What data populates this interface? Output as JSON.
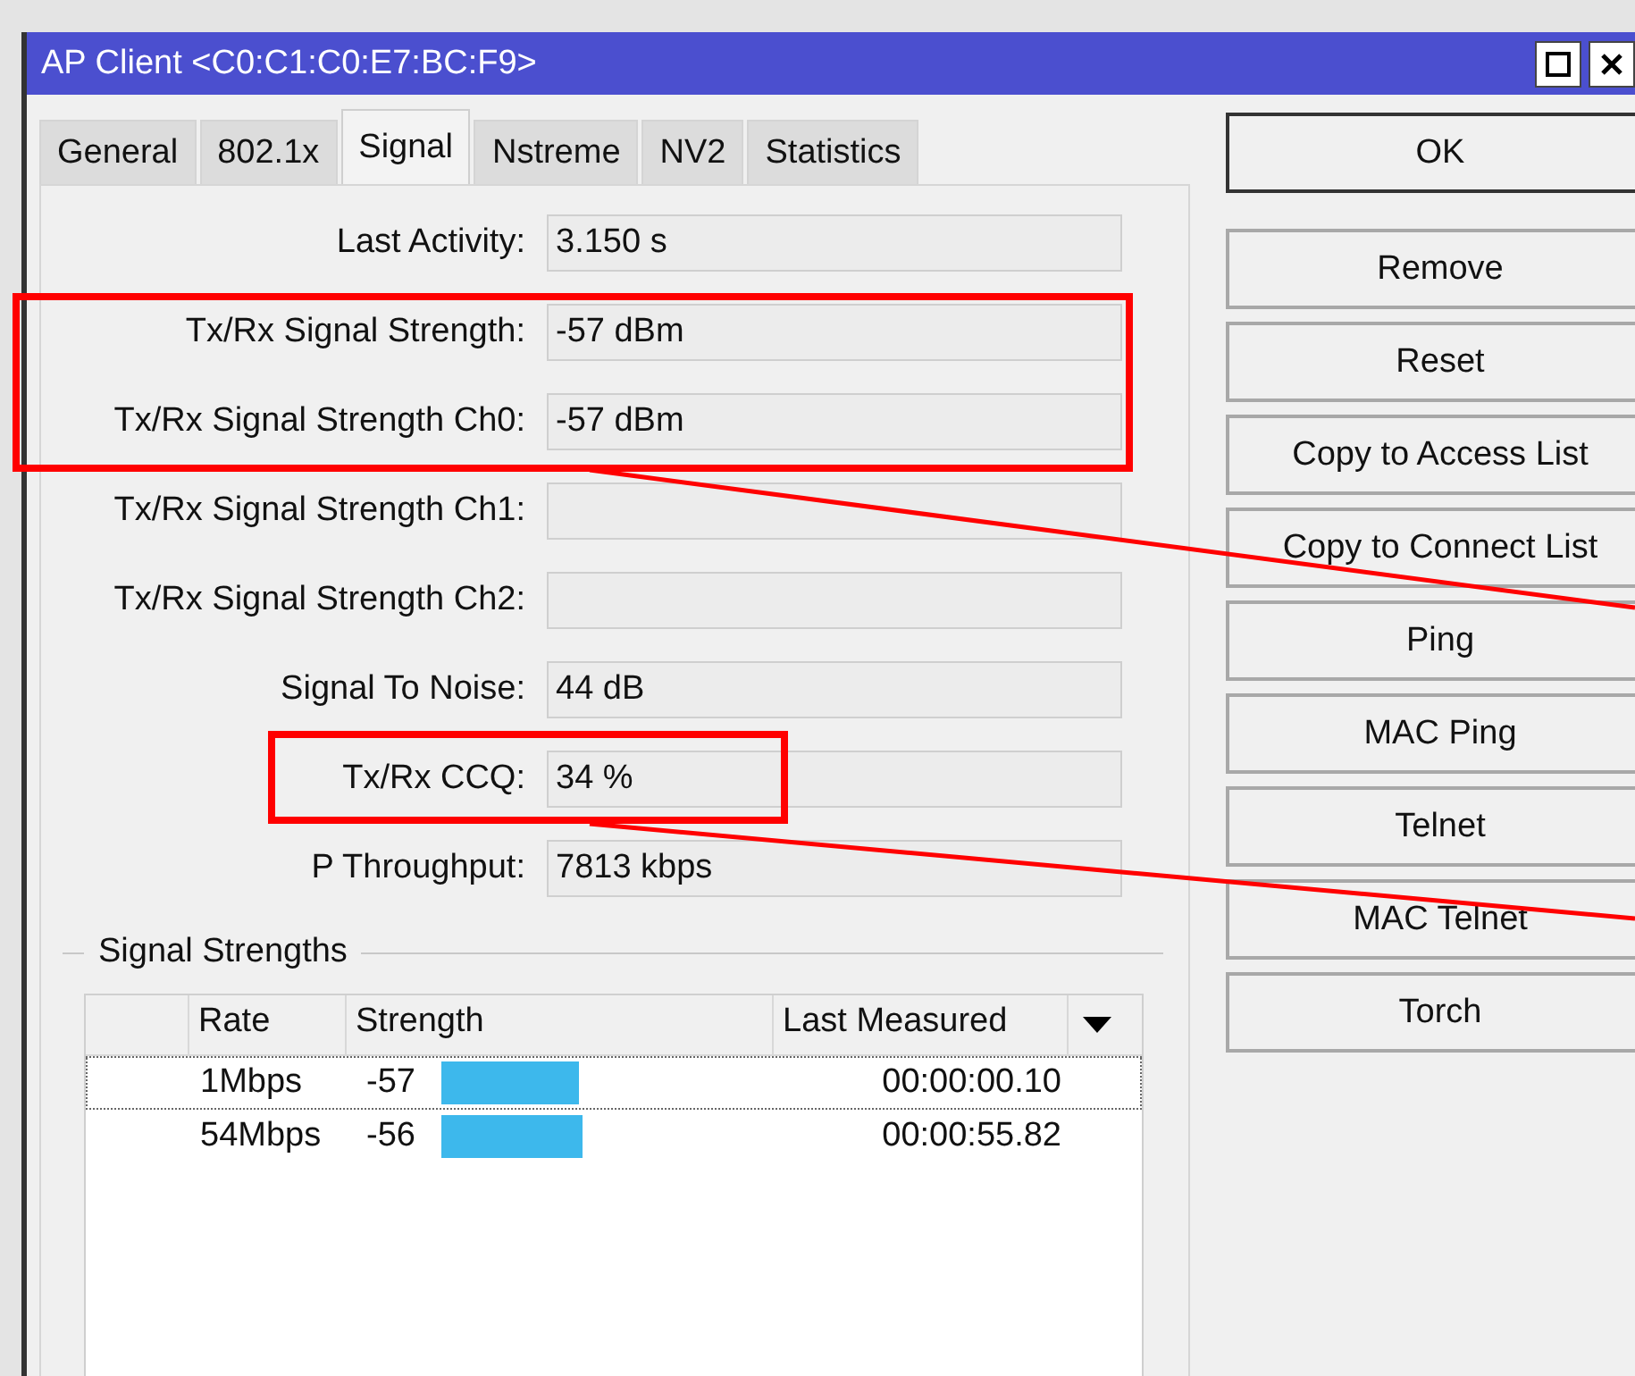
{
  "window": {
    "title": "AP Client <C0:C1:C0:E7:BC:F9>"
  },
  "tabs": [
    {
      "label": "General",
      "selected": false
    },
    {
      "label": "802.1x",
      "selected": false
    },
    {
      "label": "Signal",
      "selected": true
    },
    {
      "label": "Nstreme",
      "selected": false
    },
    {
      "label": "NV2",
      "selected": false
    },
    {
      "label": "Statistics",
      "selected": false
    }
  ],
  "fields": [
    {
      "label": "Last Activity:",
      "value": "3.150 s"
    },
    {
      "label": "Tx/Rx Signal Strength:",
      "value": "-57 dBm"
    },
    {
      "label": "Tx/Rx Signal Strength Ch0:",
      "value": "-57 dBm"
    },
    {
      "label": "Tx/Rx Signal Strength Ch1:"
    },
    {
      "label": "Tx/Rx Signal Strength Ch2:"
    },
    {
      "label": "Signal To Noise:",
      "value": "44 dB"
    },
    {
      "label": "Tx/Rx CCQ:",
      "value": "34 %"
    },
    {
      "label": "P Throughput:",
      "value": "7813 kbps"
    }
  ],
  "signal_strengths": {
    "title": "Signal Strengths",
    "columns": [
      "Rate",
      "Strength",
      "Last Measured"
    ],
    "rows": [
      {
        "rate": "1Mbps",
        "strength": "-57",
        "level": 0.43,
        "last_measured": "00:00:00.10",
        "selected": true
      },
      {
        "rate": "54Mbps",
        "strength": "-56",
        "level": 0.44,
        "last_measured": "00:00:55.82",
        "selected": false
      }
    ]
  },
  "buttons": [
    "OK",
    "Remove",
    "Reset",
    "Copy to Access List",
    "Copy to Connect List",
    "Ping",
    "MAC Ping",
    "Telnet",
    "MAC Telnet",
    "Torch"
  ]
}
